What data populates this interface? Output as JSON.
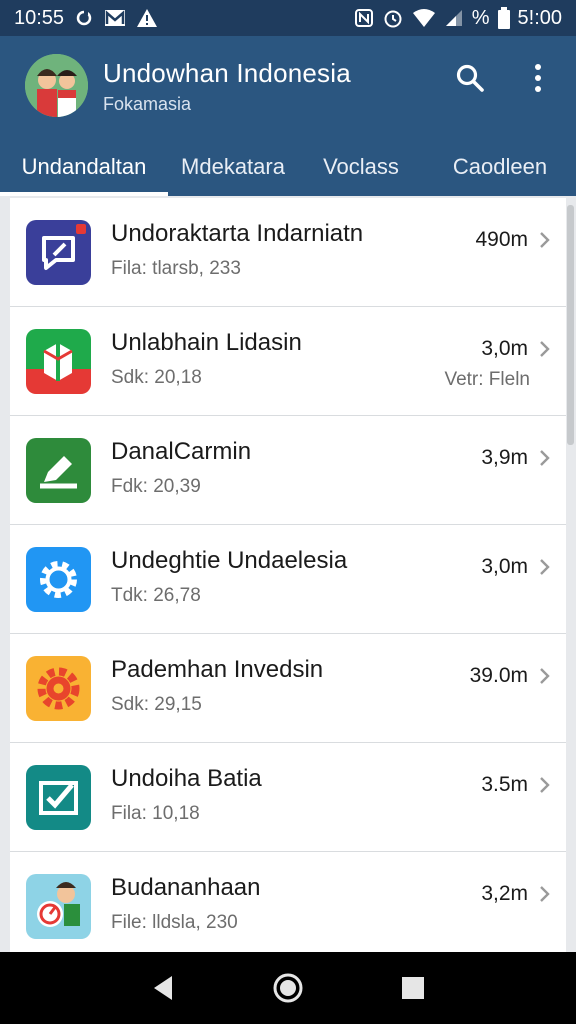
{
  "status": {
    "time": "10:55",
    "clock_right": "5!:00",
    "percent": "%",
    "icons_left": [
      "sync-icon",
      "mail-icon",
      "warning-icon"
    ],
    "icons_right": [
      "nfc-icon",
      "alarm-icon",
      "wifi-icon",
      "signal-icon"
    ]
  },
  "header": {
    "title": "Undowhan Indonesia",
    "subtitle": "Fokamasia",
    "actions": [
      "search-icon",
      "more-vert-icon"
    ],
    "tabs": [
      {
        "label": "Undandaltan",
        "active": true
      },
      {
        "label": "Mdekatara",
        "active": false
      },
      {
        "label": "Voclass",
        "active": false
      },
      {
        "label": "Caodleen",
        "active": false
      }
    ]
  },
  "list": {
    "items": [
      {
        "title": "Undoraktarta Indarniatn",
        "sub": "Fila: tlarsb, 233",
        "size": "490m",
        "extra": "",
        "icon": "chat-icon",
        "color": "#3a3f9a"
      },
      {
        "title": "Unlabhain Lidasin",
        "sub": "Sdk: 20,18",
        "size": "3,0m",
        "extra": "Vetr: Fleln",
        "icon": "map-icon",
        "color": "#ffffff"
      },
      {
        "title": "DanalCarmin",
        "sub": "Fdk: 20,39",
        "size": "3,9m",
        "extra": "",
        "icon": "edit-icon",
        "color": "#2e8b3b"
      },
      {
        "title": "Undeghtie  Undaelesia",
        "sub": "Tdk: 26,78",
        "size": "3,0m",
        "extra": "",
        "icon": "gear-icon",
        "color": "#2196f3"
      },
      {
        "title": "Pademhan Invedsin",
        "sub": "Sdk: 29,15",
        "size": "39.0m",
        "extra": "",
        "icon": "cog-icon",
        "color": "#f9b233"
      },
      {
        "title": "Undoiha Batia",
        "sub": "Fila: 10,18",
        "size": "3.5m",
        "extra": "",
        "icon": "checklist-icon",
        "color": "#138a86"
      },
      {
        "title": "Budananhaan",
        "sub": "File: lldsla, 230",
        "size": "3,2m",
        "extra": "",
        "icon": "game-icon",
        "color": "#8ed3e6"
      }
    ]
  },
  "nav": {
    "buttons": [
      "back-icon",
      "home-icon",
      "recents-icon"
    ]
  }
}
